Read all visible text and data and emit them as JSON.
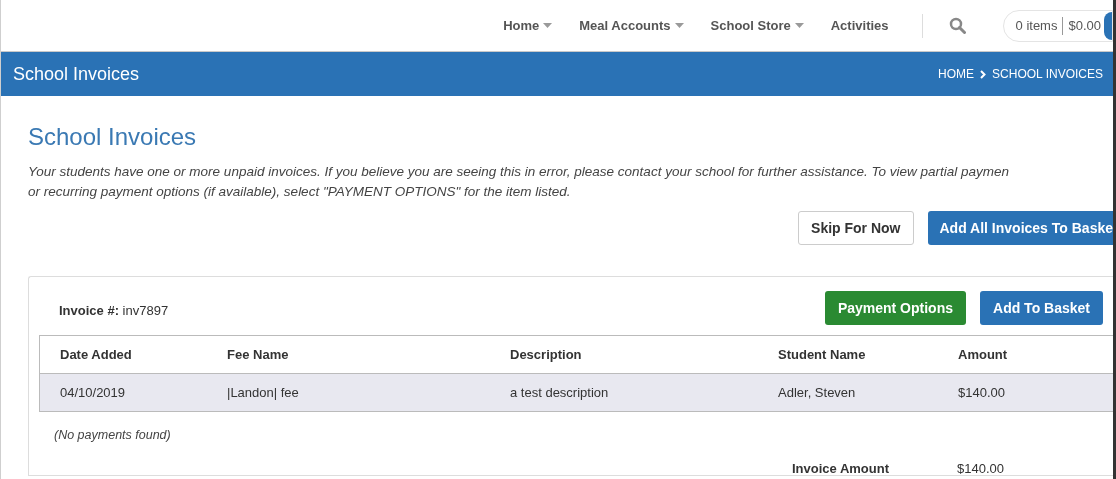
{
  "nav": {
    "items": [
      {
        "label": "Home",
        "dropdown": true
      },
      {
        "label": "Meal Accounts",
        "dropdown": true
      },
      {
        "label": "School Store",
        "dropdown": true
      },
      {
        "label": "Activities",
        "dropdown": false
      }
    ],
    "cart": {
      "items": "0 items",
      "total": "$0.00"
    }
  },
  "banner": {
    "title": "School Invoices",
    "breadcrumb": [
      "HOME",
      "SCHOOL INVOICES"
    ]
  },
  "page": {
    "title": "School Invoices",
    "message": "Your students have one or more unpaid invoices. If you believe you are seeing this in error, please contact your school for further assistance. To view partial paymen\nor recurring payment options (if available), select \"PAYMENT OPTIONS\" for the item listed.",
    "buttons": [
      "Skip For Now",
      "Add All Invoices To Baske"
    ]
  },
  "invoice": {
    "label": "Invoice #:",
    "number": "inv7897",
    "payment_button": "Payment Options",
    "basket_button": "Add To Basket",
    "columns": [
      "Date Added",
      "Fee Name",
      "Description",
      "Student Name",
      "Amount"
    ],
    "rows": [
      [
        "04/10/2019",
        "|Landon| fee",
        "a test description",
        "Adler, Steven",
        "$140.00"
      ]
    ],
    "no_payments": "(No payments found)",
    "total_label": "Invoice Amount",
    "total": "$140.00"
  }
}
